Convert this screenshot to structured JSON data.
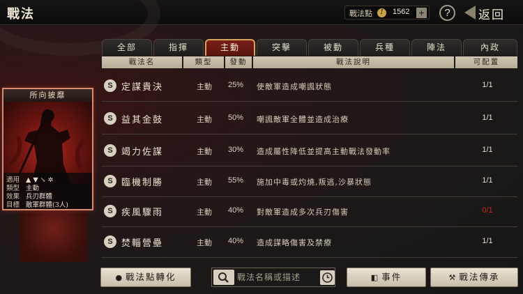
{
  "header": {
    "title": "戰法",
    "points_label": "戰法點",
    "points_value": "1562",
    "back_label": "返回"
  },
  "tabs": [
    {
      "label": "全部"
    },
    {
      "label": "指揮"
    },
    {
      "label": "主動",
      "active": true
    },
    {
      "label": "突擊"
    },
    {
      "label": "被動"
    },
    {
      "label": "兵種"
    },
    {
      "label": "陣法"
    },
    {
      "label": "內政"
    }
  ],
  "table": {
    "columns": [
      "戰法名",
      "類型",
      "發動",
      "戰法說明",
      "可配置"
    ],
    "rows": [
      {
        "grade": "S",
        "name": "定謀貴決",
        "type": "主動",
        "rate": "25%",
        "desc": "使敵軍造成嘲諷狀態",
        "count": "1/1"
      },
      {
        "grade": "S",
        "name": "益其金鼓",
        "type": "主動",
        "rate": "50%",
        "desc": "嘲諷敵軍全體並造成治療",
        "count": "1/1"
      },
      {
        "grade": "S",
        "name": "竭力佐謀",
        "type": "主動",
        "rate": "30%",
        "desc": "造成屬性降低並提高主動戰法發動率",
        "count": "1/1"
      },
      {
        "grade": "S",
        "name": "臨機制勝",
        "type": "主動",
        "rate": "55%",
        "desc": "施加中毒或灼燒,叛逃,沙暴狀態",
        "count": "1/1"
      },
      {
        "grade": "S",
        "name": "疾風驟雨",
        "type": "主動",
        "rate": "40%",
        "desc": "對敵軍造成多次兵刃傷害",
        "count": "0/1",
        "unavailable": true
      },
      {
        "grade": "S",
        "name": "焚輜營壘",
        "type": "主動",
        "rate": "40%",
        "desc": "造成謀略傷害及禁療",
        "count": "1/1"
      }
    ]
  },
  "card": {
    "title": "所向披靡",
    "rows": [
      {
        "key": "適用",
        "value": "▲ ▼ ↘ ✲"
      },
      {
        "key": "類型",
        "value": "主動"
      },
      {
        "key": "效果",
        "value": "兵刃群體"
      },
      {
        "key": "目標",
        "value": "敵軍群體(3人)"
      }
    ]
  },
  "footer": {
    "convert_label": "戰法點轉化",
    "search_placeholder": "戰法名稱或描述",
    "events_label": "事件",
    "inherit_label": "戰法傳承"
  },
  "colors": {
    "accent": "#d4a55b",
    "active_tab": "#7a1f16",
    "unavailable": "#c22a22"
  }
}
